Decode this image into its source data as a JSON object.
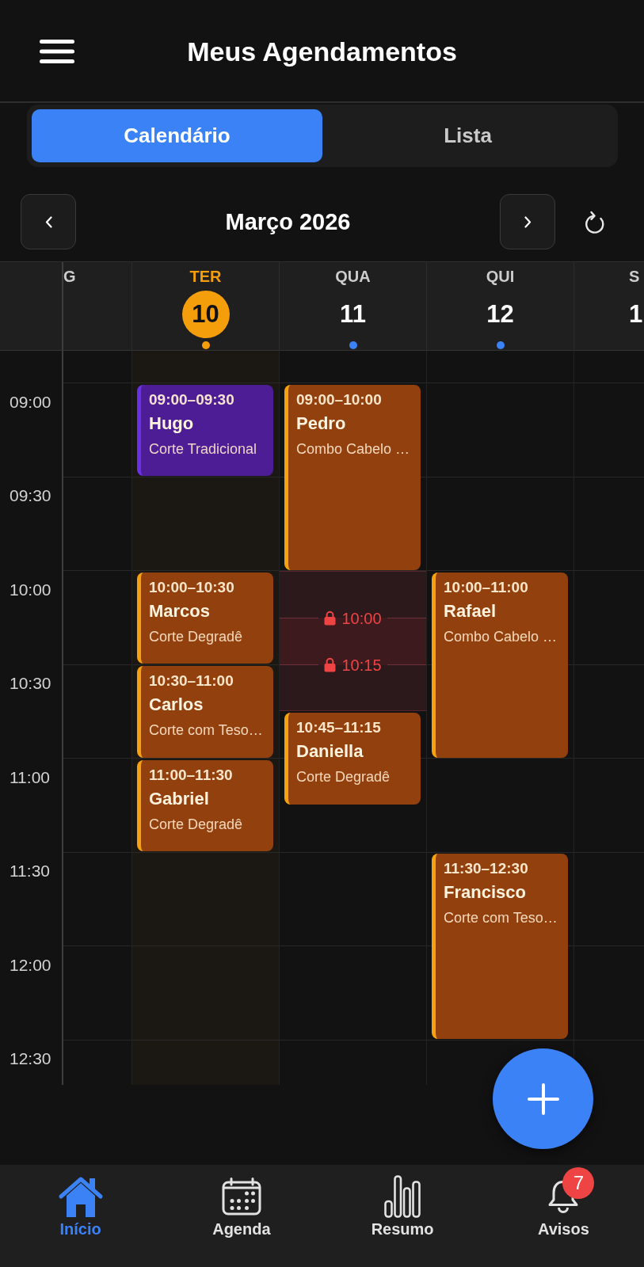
{
  "header": {
    "title": "Meus Agendamentos"
  },
  "view_tabs": [
    {
      "label": "Calendário",
      "selected": true
    },
    {
      "label": "Lista",
      "selected": false
    }
  ],
  "month_nav": {
    "title": "Março 2026"
  },
  "calendar": {
    "time_labels": [
      "09:00",
      "09:30",
      "10:00",
      "10:30",
      "11:00",
      "11:30",
      "12:00",
      "12:30"
    ],
    "days": [
      {
        "kind": "cut_start",
        "name": "G",
        "today": false,
        "dot": false
      },
      {
        "kind": "full",
        "name": "TER",
        "date": "10",
        "today": true,
        "dot": true,
        "events": [
          {
            "time": "09:00–09:30",
            "client": "Hugo",
            "service": "Corte Tradicional",
            "color": "#4c1d95"
          },
          {
            "time": "10:00–10:30",
            "client": "Marcos",
            "service": "Corte Degradê",
            "color": "#92400e"
          },
          {
            "time": "10:30–11:00",
            "client": "Carlos",
            "service": "Corte com Teso…",
            "color": "#92400e"
          },
          {
            "time": "11:00–11:30",
            "client": "Gabriel",
            "service": "Corte Degradê",
            "color": "#92400e"
          }
        ]
      },
      {
        "kind": "full",
        "name": "QUA",
        "date": "11",
        "today": false,
        "dot": true,
        "events": [
          {
            "time": "09:00–10:00",
            "client": "Pedro",
            "service": "Combo Cabelo …",
            "color": "#92400e"
          },
          {
            "time": "10:45–11:15",
            "client": "Daniella",
            "service": "Corte Degradê",
            "color": "#92400e"
          }
        ],
        "blocked": [
          "10:00",
          "10:15"
        ]
      },
      {
        "kind": "full",
        "name": "QUI",
        "date": "12",
        "today": false,
        "dot": true,
        "events": [
          {
            "time": "10:00–11:00",
            "client": "Rafael",
            "service": "Combo Cabelo …",
            "color": "#92400e"
          },
          {
            "time": "11:30–12:30",
            "client": "Francisco",
            "service": "Corte com Teso…",
            "color": "#92400e"
          }
        ]
      },
      {
        "kind": "cut_end",
        "name": "S",
        "date": "1",
        "today": false,
        "dot": false
      }
    ]
  },
  "bottom_nav": [
    {
      "label": "Início",
      "selected": true
    },
    {
      "label": "Agenda",
      "selected": false
    },
    {
      "label": "Resumo",
      "selected": false
    },
    {
      "label": "Avisos",
      "selected": false,
      "badge": "7"
    }
  ]
}
